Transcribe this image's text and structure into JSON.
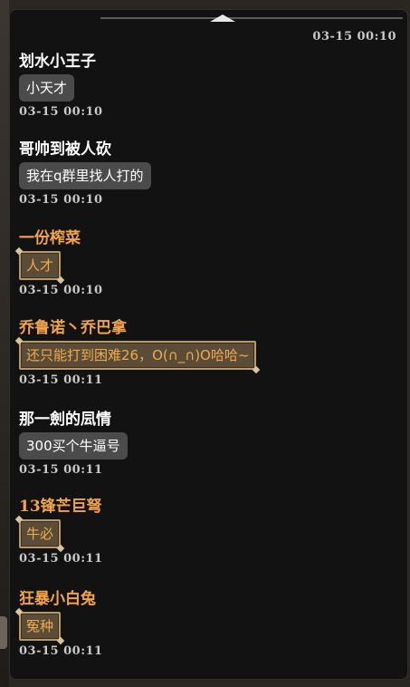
{
  "header": {
    "time": "03-15   00:10"
  },
  "messages": [
    {
      "sender": "划水小王子",
      "text": "小天才",
      "time": "03-15   00:10",
      "style": "normal"
    },
    {
      "sender": "哥帅到被人砍",
      "text": "我在q群里找人打的",
      "time": "03-15   00:10",
      "style": "normal"
    },
    {
      "sender": "一份榨菜",
      "text": "人才",
      "time": "03-15   00:10",
      "style": "vip"
    },
    {
      "sender": "乔鲁诺丶乔巴拿",
      "text": "还只能打到困难26，O(∩_∩)O哈哈~",
      "time": "03-15   00:11",
      "style": "vip"
    },
    {
      "sender": "那一劍的凨情",
      "text": "300买个牛逼号",
      "time": "03-15   00:11",
      "style": "normal"
    },
    {
      "sender": "13锋芒巨弩",
      "text": "牛必",
      "time": "03-15   00:11",
      "style": "vip"
    },
    {
      "sender": "狂暴小白兔",
      "text": "冤种",
      "time": "03-15   00:11",
      "style": "vip"
    }
  ],
  "colors": {
    "vip_name": "#f2a44a",
    "normal_name": "#ffffff",
    "panel_bg": "#121212"
  }
}
